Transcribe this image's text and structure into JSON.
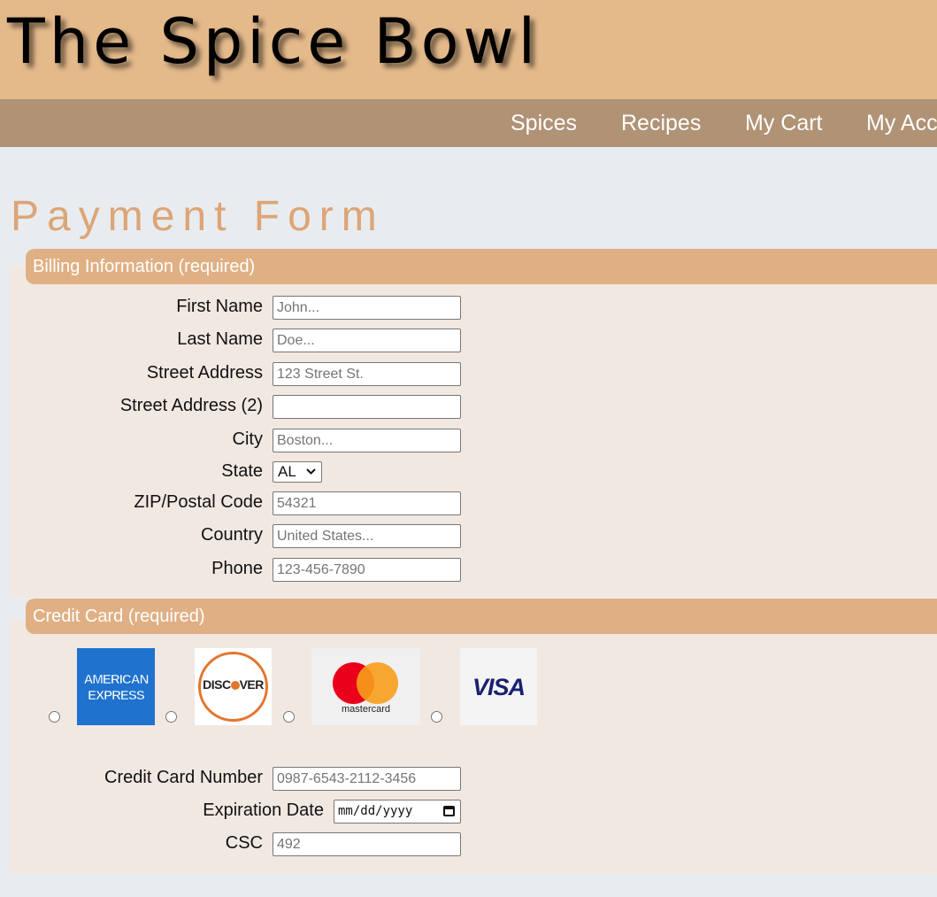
{
  "site": {
    "title": "The Spice Bowl"
  },
  "nav": {
    "items": [
      "Spices",
      "Recipes",
      "My Cart",
      "My Acc"
    ]
  },
  "page": {
    "title": "Payment Form"
  },
  "billing": {
    "legend": "Billing Information (required)",
    "first_name": {
      "label": "First Name",
      "placeholder": "John..."
    },
    "last_name": {
      "label": "Last Name",
      "placeholder": "Doe..."
    },
    "street1": {
      "label": "Street Address",
      "placeholder": "123 Street St."
    },
    "street2": {
      "label": "Street Address (2)",
      "placeholder": ""
    },
    "city": {
      "label": "City",
      "placeholder": "Boston..."
    },
    "state": {
      "label": "State",
      "value": "AL"
    },
    "zip": {
      "label": "ZIP/Postal Code",
      "placeholder": "54321"
    },
    "country": {
      "label": "Country",
      "placeholder": "United States..."
    },
    "phone": {
      "label": "Phone",
      "placeholder": "123-456-7890"
    }
  },
  "card": {
    "legend": "Credit Card (required)",
    "logos": {
      "amex_line1": "AMERICAN",
      "amex_line2": "EXPRESS",
      "discover_pre": "DISC",
      "discover_post": "VER",
      "mastercard": "mastercard",
      "visa": "VISA"
    },
    "number": {
      "label": "Credit Card Number",
      "placeholder": "0987-6543-2112-3456"
    },
    "expiration": {
      "label": "Expiration Date",
      "placeholder": "mm/dd/yyyy"
    },
    "csc": {
      "label": "CSC",
      "placeholder": "492"
    }
  },
  "colors": {
    "header_bg": "#e5ba8b",
    "nav_bg": "#b09275",
    "legend_bg": "#e0b084",
    "title_color": "#dca577",
    "panel_bg": "#f1e8e2",
    "page_bg": "#e9ecef"
  },
  "icons": {
    "state_select": "chevron-down-icon",
    "date_picker": "calendar-icon"
  }
}
